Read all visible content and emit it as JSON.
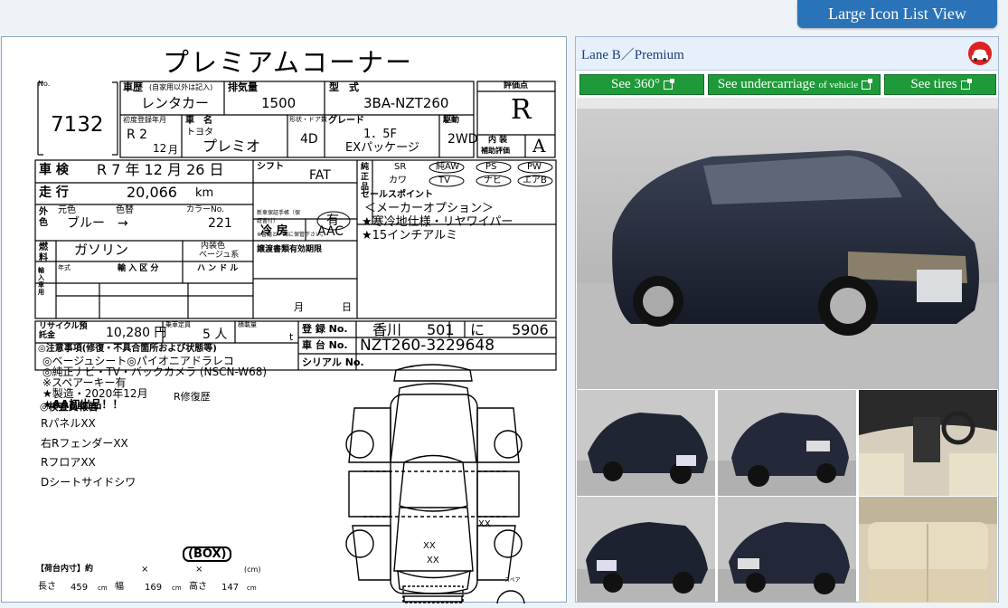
{
  "toolbar": {
    "view_label": "Large Icon List View"
  },
  "sheet": {
    "title": "プレミアムコーナー",
    "lot_label": "No.",
    "lot_number": "7132",
    "history_label": "車歴",
    "history_note": "(自家用以外は記入)",
    "history_value": "レンタカー",
    "displacement_label": "排気量",
    "displacement_value": "1500",
    "model_code_label": "型　式",
    "model_code_value": "3BA-NZT260",
    "grade_score_label": "評価点",
    "grade_score_value": "R",
    "first_reg_label": "初度登録年月",
    "first_reg_era": "R 2",
    "first_reg_month": "12",
    "first_reg_month_unit": "月",
    "make_label": "車　名",
    "make_value": "トヨタ",
    "name_value": "プレミオ",
    "doors_label": "形状・ドア数",
    "doors_value": "4D",
    "grade_label": "グレード",
    "grade_value_1": "1．5F",
    "grade_value_2": "EXパッケージ",
    "drive_label": "駆動",
    "drive_value": "2WD",
    "interior_label": "内 装",
    "interior_sub_label": "補助評価",
    "interior_score": "A",
    "inspection_label": "車 検",
    "inspection_value": "R 7 年 12 月 26 日",
    "shift_label": "シフト",
    "shift_value": "FAT",
    "equip_label": "純正品",
    "equip_row1": [
      "SR",
      "純AW",
      "PS",
      "PW"
    ],
    "equip_row2": [
      "カワ",
      "TV",
      "ナビ",
      "エアB"
    ],
    "mileage_label": "走 行",
    "mileage_value": "20,066",
    "mileage_unit": "km",
    "ac_label": "冷 房",
    "ac_value": "AAC",
    "sales_points_label": "セールスポイント",
    "sales_points": [
      "＜メーカーオプション＞",
      "★寒冷地仕様・リヤワイパー",
      "★15インチアルミ"
    ],
    "color_label": "外色",
    "color_original_label": "元色",
    "color_repaint_label": "色替",
    "color_code_label": "カラーNo.",
    "color_value": "ブルー　→",
    "color_code_value": "221",
    "manual_label": "新車保証手帳（保証書付）",
    "manual_value": "有",
    "manual_note": "※書籍と一緒に保管下さい。",
    "fuel_label": "燃料",
    "fuel_value": "ガソリン",
    "interior_color_label": "内装色",
    "interior_color_value": "ベージュ系",
    "import_label": "輸入車用",
    "import_year_label": "年式",
    "import_class_label": "輸 入 区 分",
    "handle_label": "ハ ン ド ル",
    "document_label": "譲渡書類有効期限",
    "document_month": "月",
    "document_day": "日",
    "recycle_label": "リサイクル預託金",
    "recycle_value": "10,280 円",
    "capacity_label": "乗車定員",
    "capacity_value": "5 人",
    "load_label": "積載量",
    "load_unit": "t",
    "reg_label": "登 録 No.",
    "reg_values": [
      "香川",
      "501",
      "に",
      "5906"
    ],
    "chassis_label": "車 台 No.",
    "chassis_value": "NZT260-3229648",
    "serial_label": "シリアル No.",
    "notes_label": "◎注意事項(修復・不具合箇所および状態等)",
    "notes": [
      "◎ベージュシート◎パイオニアドラレコ",
      "◎純正ナビ・TV・バックカメラ (NSCN-W68)",
      "※スペアーキー有",
      "★製造・2020年12月",
      "★AA初出品！！"
    ],
    "repair_label": "R修復歴",
    "inspector_label": "◎検査員報告",
    "inspector_items": [
      "RパネルXX",
      "右RフェンダーXX",
      "RフロアXX",
      "Dシートサイドシワ"
    ],
    "diagram_marks": [
      "XX",
      "XX",
      "XX"
    ],
    "spare_label": "スペア",
    "box_label": "(BOX)",
    "cargo_label": "【荷台内寸】約",
    "cargo_x1": "×",
    "cargo_x2": "×",
    "cargo_unit": "(cm)",
    "length_label": "長さ",
    "length_value": "459",
    "width_label": "幅",
    "width_value": "169",
    "height_label": "高さ",
    "height_value": "147",
    "cm": "cm"
  },
  "panel": {
    "lane_title": "Lane B／Premium",
    "buttons": {
      "view360": "See 360°",
      "undercarriage": "See undercarriage",
      "undercarriage_small": "of vehicle",
      "tires": "See tires"
    }
  },
  "colors": {
    "accent_blue": "#2a73b8",
    "button_green": "#1f9a3a",
    "car_body": "#1b2231"
  }
}
